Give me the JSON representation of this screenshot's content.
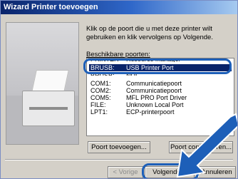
{
  "window": {
    "title": "Wizard Printer toevoegen"
  },
  "instructions": "Klik op de poort die u met deze printer wilt gebruiken en klik vervolgens op Volgende.",
  "ports_label": "Beschikbare poorten:",
  "ports": [
    {
      "name": "BRUSB:",
      "description": "USB Printer Port",
      "selected": true
    },
    {
      "name": "COM1:",
      "description": "Communicatiepoort",
      "selected": false
    },
    {
      "name": "COM2:",
      "description": "Communicatiepoort",
      "selected": false
    },
    {
      "name": "COM5:",
      "description": "MFL PRO Port Driver",
      "selected": false
    },
    {
      "name": "FILE:",
      "description": "Unknown Local Port",
      "selected": false
    },
    {
      "name": "LPT1:",
      "description": "ECP-printerpoort",
      "selected": false
    }
  ],
  "buttons": {
    "add_port": "Poort toevoegen...",
    "configure_port": "Poort configureren...",
    "back": "< Vorige",
    "next": "Volgende >",
    "cancel": "Annuleren"
  },
  "colors": {
    "title_start": "#0a246a",
    "title_end": "#a6caf0",
    "selection": "#0a246a",
    "highlight": "#1d5fb8"
  },
  "icons": [
    "printer-illustration",
    "callout-arrow-icon"
  ]
}
